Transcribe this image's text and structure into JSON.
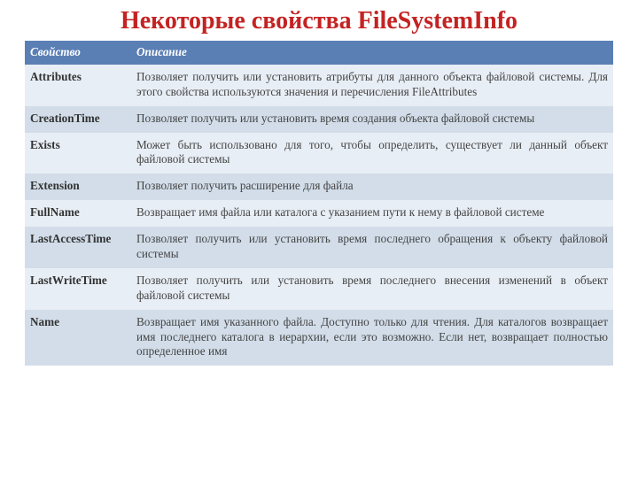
{
  "title": "Некоторые свойства FileSystemInfo",
  "headers": {
    "property": "Свойство",
    "description": "Описание"
  },
  "rows": [
    {
      "property": "Attributes",
      "description": "Позволяет получить или установить атрибуты для данного объекта файловой системы. Для этого свойства используются значения и перечисления FileAttributes"
    },
    {
      "property": "CreationTime",
      "description": "Позволяет получить или установить время создания объекта файловой системы"
    },
    {
      "property": "Exists",
      "description": "Может быть использовано для того, чтобы определить, существует ли данный объект файловой системы"
    },
    {
      "property": "Extension",
      "description": " Позволяет получить расширение для файла"
    },
    {
      "property": "FullName",
      "description": "Возвращает имя файла или каталога с указанием пути к нему в файловой системе"
    },
    {
      "property": "LastAccessTime",
      "description": "Позволяет получить или установить время последнего обращения к объекту файловой системы"
    },
    {
      "property": "LastWriteTime",
      "description": "Позволяет получить или установить время последнего внесения изменений в объект файловой системы"
    },
    {
      "property": "Name",
      "description": "Возвращает имя указанного файла. Доступно только для чтения. Для каталогов возвращает имя последнего каталога в иерархии, если это возможно. Если нет, возвращает полностью определенное имя"
    }
  ]
}
